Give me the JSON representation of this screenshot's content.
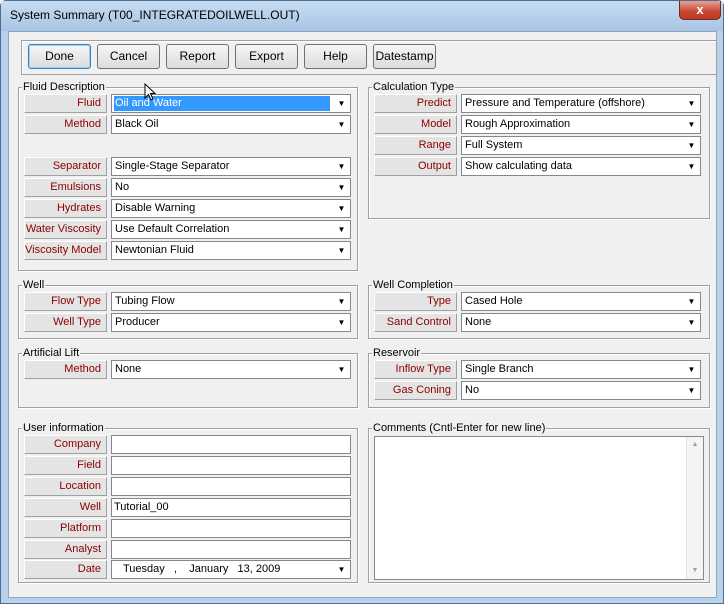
{
  "window": {
    "title": "System Summary (T00_INTEGRATEDOILWELL.OUT)",
    "close_glyph": "x"
  },
  "toolbar": {
    "done": "Done",
    "cancel": "Cancel",
    "report": "Report",
    "export": "Export",
    "help": "Help",
    "datestamp": "Datestamp"
  },
  "fluid": {
    "title": "Fluid Description",
    "fluid_label": "Fluid",
    "fluid_value": "Oil and Water",
    "method_label": "Method",
    "method_value": "Black Oil",
    "separator_label": "Separator",
    "separator_value": "Single-Stage Separator",
    "emulsions_label": "Emulsions",
    "emulsions_value": "No",
    "hydrates_label": "Hydrates",
    "hydrates_value": "Disable Warning",
    "water_visc_label": "Water Viscosity",
    "water_visc_value": "Use Default Correlation",
    "visc_model_label": "Viscosity Model",
    "visc_model_value": "Newtonian Fluid"
  },
  "calc": {
    "title": "Calculation Type",
    "predict_label": "Predict",
    "predict_value": "Pressure and Temperature (offshore)",
    "model_label": "Model",
    "model_value": "Rough Approximation",
    "range_label": "Range",
    "range_value": "Full System",
    "output_label": "Output",
    "output_value": "Show calculating data"
  },
  "well": {
    "title": "Well",
    "flow_label": "Flow Type",
    "flow_value": "Tubing Flow",
    "type_label": "Well Type",
    "type_value": "Producer"
  },
  "completion": {
    "title": "Well Completion",
    "type_label": "Type",
    "type_value": "Cased Hole",
    "sand_label": "Sand Control",
    "sand_value": "None"
  },
  "lift": {
    "title": "Artificial Lift",
    "method_label": "Method",
    "method_value": "None"
  },
  "reservoir": {
    "title": "Reservoir",
    "inflow_label": "Inflow Type",
    "inflow_value": "Single Branch",
    "gas_label": "Gas Coning",
    "gas_value": "No"
  },
  "user": {
    "title": "User information",
    "company_label": "Company",
    "company_value": "",
    "field_label": "Field",
    "field_value": "",
    "location_label": "Location",
    "location_value": "",
    "well_label": "Well",
    "well_value": "Tutorial_00",
    "platform_label": "Platform",
    "platform_value": "",
    "analyst_label": "Analyst",
    "analyst_value": "",
    "date_label": "Date",
    "date_value": "Tuesday   ,    January   13, 2009"
  },
  "comments": {
    "title": "Comments (Cntl-Enter for new line)",
    "value": ""
  },
  "icons": {
    "dropdown": "chevron-down-icon",
    "scroll_up": "scroll-up-icon",
    "scroll_down": "scroll-down-icon",
    "cursor": "mouse-cursor-icon"
  },
  "colors": {
    "label_text": "#8b0000",
    "selection": "#3399ff",
    "titlebar": "#b9d1ea",
    "close": "#c94530"
  }
}
